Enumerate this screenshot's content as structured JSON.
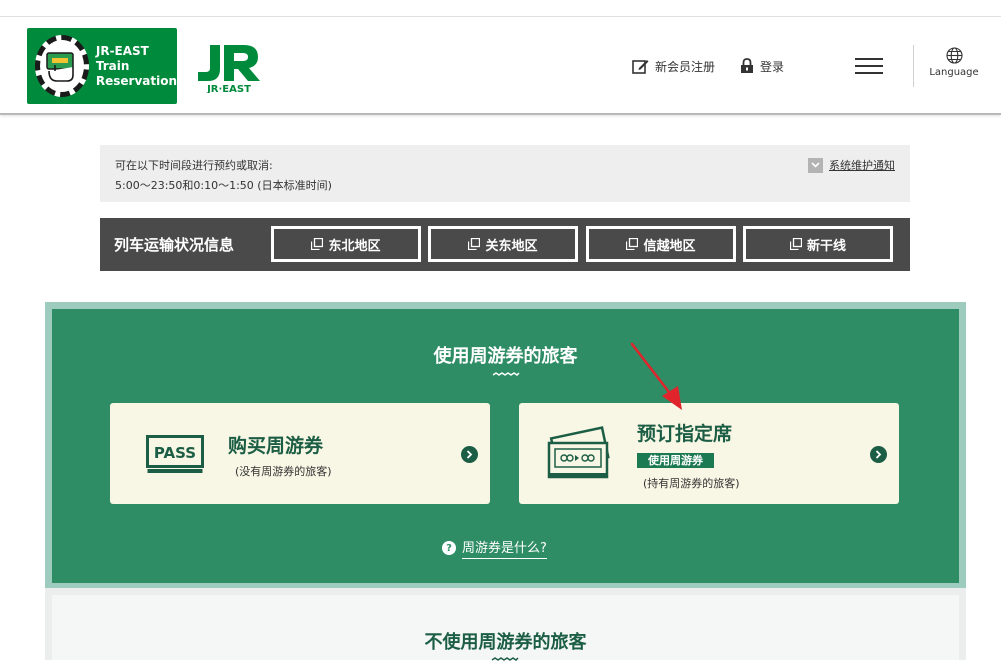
{
  "header": {
    "logo_text": "JR-EAST\nTrain\nReservation",
    "brand_mark": "JR EAST",
    "nav": {
      "register": "新会员注册",
      "login": "登录",
      "language": "Language"
    }
  },
  "notice": {
    "line1": "可在以下时间段进行预约或取消:",
    "line2": "5:00～23:50和0:10～1:50 (日本标准时间)",
    "maintenance_link": "系统维护通知"
  },
  "traffic": {
    "title": "列车运输状况信息",
    "buttons": [
      "东北地区",
      "关东地区",
      "信越地区",
      "新干线"
    ]
  },
  "pass_section": {
    "title": "使用周游券的旅客",
    "buy": {
      "icon_text": "PASS",
      "title": "购买周游券",
      "subtitle": "(没有周游券的旅客)"
    },
    "reserve": {
      "title": "预订指定席",
      "badge": "使用周游券",
      "subtitle": "(持有周游券的旅客)"
    },
    "what_link": "周游券是什么?"
  },
  "nopass_section": {
    "title": "不使用周游券的旅客"
  },
  "colors": {
    "brand_green": "#008a3c",
    "section_green": "#2f8d66",
    "dark_green": "#1c5e45",
    "card_bg": "#f8f6e4",
    "traffic_bg": "#4a4a4a",
    "annotation_red": "#e0242b"
  }
}
